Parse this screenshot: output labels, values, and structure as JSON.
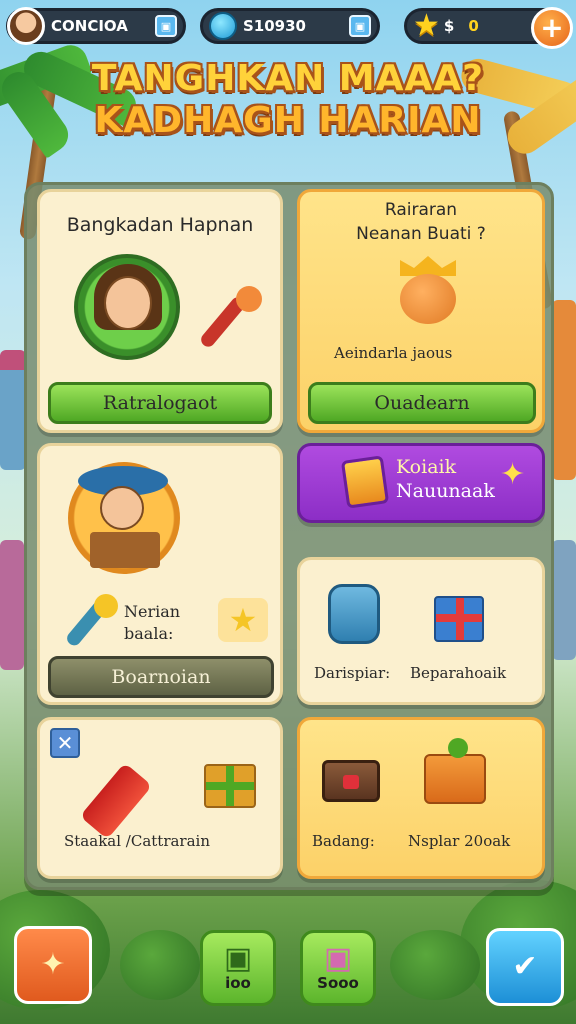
{
  "header": {
    "player_name": "CONCIOA",
    "coins": "S10930",
    "stars_symbol": "$",
    "stars_value": "0",
    "plus": "+"
  },
  "title": {
    "line1": "TANGHKAN MAAA?",
    "line2": "KADHAGH HARIAN"
  },
  "cards": {
    "daily_login": {
      "title": "Bangkadan Hapnan",
      "button": "Ratralogaot"
    },
    "special_reward": {
      "title_line1": "Rairaran",
      "title_line2": "Neanan Buati ?",
      "label": "Aeindarla jaous",
      "button": "Ouadearn"
    },
    "store_worker": {
      "label_line1": "Nerian",
      "label_line2": "baala:",
      "button": "Boarnoian"
    },
    "purple_event": {
      "line1": "Koiaik",
      "line2": "Nauunaak"
    },
    "bag_gift": {
      "label_left": "Darispiar:",
      "label_right": "Beparahoaik"
    },
    "items_box": {
      "label": "Staakal /Cattrarain"
    },
    "delivery_box": {
      "label_left": "Badang:",
      "label_right": "Nsplar 20oak"
    }
  },
  "nav": {
    "inventory_label": "ioo",
    "shop_label": "Sooo"
  },
  "colors": {
    "accent_gold": "#ffd23a",
    "title_outline": "#a8531a",
    "green_button": "#4fa824",
    "purple_event": "#8c2ec6"
  },
  "icons": [
    "avatar",
    "coin-icon",
    "star-icon",
    "plus-icon",
    "microphone-icon",
    "crown-icon",
    "card-icon",
    "backpack-icon",
    "gift-icon",
    "firecracker-icon",
    "treasure-box-icon",
    "cart-icon",
    "close-icon",
    "chat-icon"
  ]
}
